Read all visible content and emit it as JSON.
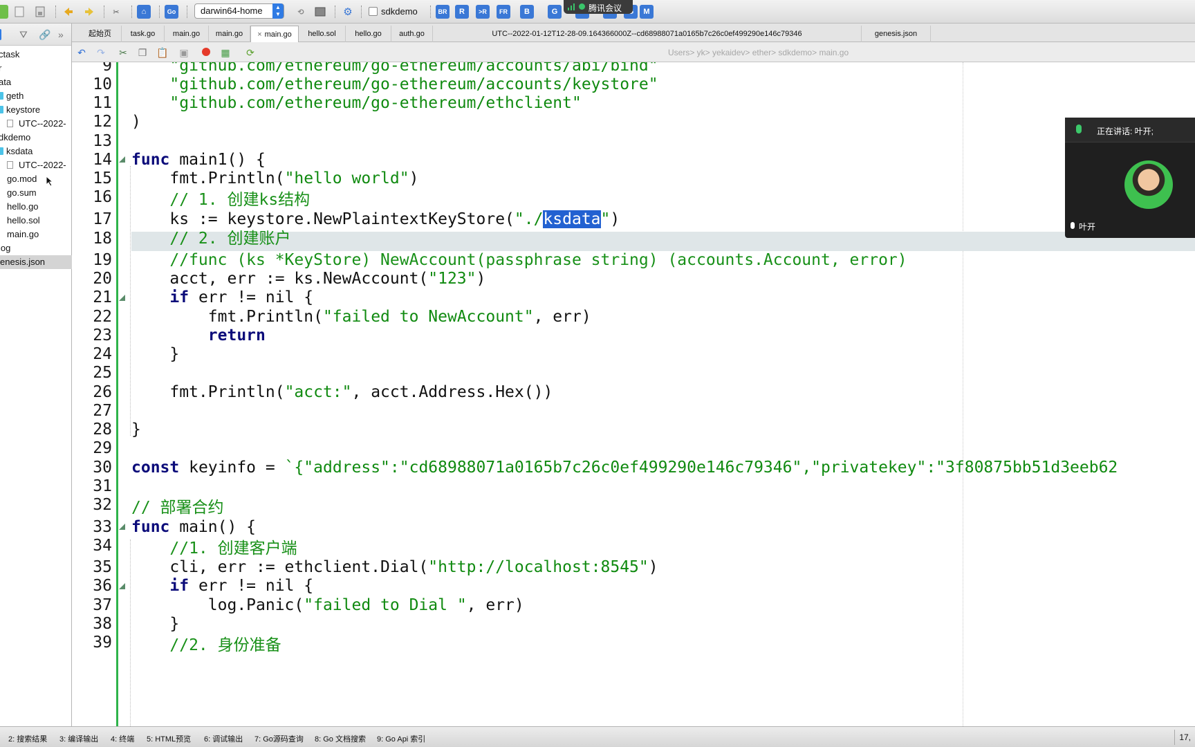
{
  "toolbar": {
    "environment_select": "darwin64-home",
    "checkbox_label": "sdkdemo",
    "checkbox_checked": false,
    "meeting_badge": "腾讯会议",
    "icons": [
      "back-icon",
      "new-file-icon",
      "save-icon",
      "prev-icon",
      "next-icon",
      "tools-icon",
      "home-icon",
      "go-icon",
      "refresh-icon",
      "terminal-icon",
      "settings-icon",
      "br-icon",
      "r-icon",
      "run-r-icon",
      "fr-icon",
      "b-icon",
      "g-icon",
      "m-icon"
    ]
  },
  "sidebar": {
    "items": [
      {
        "label": "ctask",
        "type": "folder-open"
      },
      {
        "label": "r",
        "type": "folder-open"
      },
      {
        "label": "ata",
        "type": "folder-open"
      },
      {
        "label": "geth",
        "type": "folder"
      },
      {
        "label": "keystore",
        "type": "folder"
      },
      {
        "label": "UTC--2022-",
        "type": "file"
      },
      {
        "label": "dkdemo",
        "type": "folder-open"
      },
      {
        "label": "ksdata",
        "type": "folder"
      },
      {
        "label": "UTC--2022-",
        "type": "file"
      },
      {
        "label": "go.mod",
        "type": "file"
      },
      {
        "label": "go.sum",
        "type": "file"
      },
      {
        "label": "hello.go",
        "type": "file"
      },
      {
        "label": "hello.sol",
        "type": "file"
      },
      {
        "label": "main.go",
        "type": "file"
      },
      {
        "label": "log",
        "type": "folder"
      },
      {
        "label": "enesis.json",
        "type": "file",
        "selected": true
      }
    ]
  },
  "tabs": [
    {
      "label": "起始页"
    },
    {
      "label": "task.go"
    },
    {
      "label": "main.go"
    },
    {
      "label": "main.go"
    },
    {
      "label": "main.go",
      "active": true,
      "closable": true
    },
    {
      "label": "hello.sol"
    },
    {
      "label": "hello.go"
    },
    {
      "label": "auth.go"
    },
    {
      "label": "UTC--2022-01-12T12-28-09.164366000Z--cd68988071a0165b7c26c0ef499290e146c79346"
    },
    {
      "label": "genesis.json"
    }
  ],
  "breadcrumb": "Users> yk> yekaidev> ether> sdkdemo> main.go",
  "editor": {
    "current_line": 17,
    "selected_text": "ksdata",
    "lines": [
      {
        "n": "9"
      },
      {
        "n": "10"
      },
      {
        "n": "11"
      },
      {
        "n": "12"
      },
      {
        "n": "13"
      },
      {
        "n": "14"
      },
      {
        "n": "15"
      },
      {
        "n": "16"
      },
      {
        "n": "17"
      },
      {
        "n": "18"
      },
      {
        "n": "19"
      },
      {
        "n": "20"
      },
      {
        "n": "21"
      },
      {
        "n": "22"
      },
      {
        "n": "23"
      },
      {
        "n": "24"
      },
      {
        "n": "25"
      },
      {
        "n": "26"
      },
      {
        "n": "27"
      },
      {
        "n": "28"
      },
      {
        "n": "29"
      },
      {
        "n": "30"
      },
      {
        "n": "31"
      },
      {
        "n": "32"
      },
      {
        "n": "33"
      },
      {
        "n": "34"
      },
      {
        "n": "35"
      },
      {
        "n": "36"
      },
      {
        "n": "37"
      },
      {
        "n": "38"
      },
      {
        "n": "39"
      }
    ],
    "code": {
      "l9": "\"github.com/ethereum/go-ethereum/accounts/abi/bind\"",
      "l10": "\"github.com/ethereum/go-ethereum/accounts/keystore\"",
      "l11": "\"github.com/ethereum/go-ethereum/ethclient\"",
      "l12": ")",
      "l14_kw": "func",
      "l14_rest": " main1() {",
      "l15_a": "fmt.Println(",
      "l15_s": "\"hello world\"",
      "l15_b": ")",
      "l16": "// 1. 创建ks结构",
      "l17_a": "ks := keystore.NewPlaintextKeyStore(",
      "l17_s1": "\"./",
      "l17_sel": "ksdata",
      "l17_s2": "\"",
      "l17_b": ")",
      "l18": "// 2. 创建账户",
      "l19": "//func (ks *KeyStore) NewAccount(passphrase string) (accounts.Account, error)",
      "l20_a": "acct, err := ks.NewAccount(",
      "l20_s": "\"123\"",
      "l20_b": ")",
      "l21_kw": "if",
      "l21_rest": " err != nil {",
      "l22_a": "fmt.Println(",
      "l22_s": "\"failed to NewAccount\"",
      "l22_b": ", err)",
      "l23_kw": "return",
      "l24": "}",
      "l26_a": "fmt.Println(",
      "l26_s": "\"acct:\"",
      "l26_b": ", acct.Address.Hex())",
      "l28": "}",
      "l30_kw": "const",
      "l30_a": " keyinfo = ",
      "l30_s": "`{\"address\":\"cd68988071a0165b7c26c0ef499290e146c79346\",\"privatekey\":\"3f80875bb51d3eeb62",
      "l32": "// 部署合约",
      "l33_kw": "func",
      "l33_rest": " main() {",
      "l34": "//1. 创建客户端",
      "l35_a": "cli, err := ethclient.Dial(",
      "l35_s": "\"http://localhost:8545\"",
      "l35_b": ")",
      "l36_kw": "if",
      "l36_rest": " err != nil {",
      "l37_a": "log.Panic(",
      "l37_s": "\"failed to Dial \"",
      "l37_b": ", err)",
      "l38": "}",
      "l39": "//2. 身份准备"
    }
  },
  "meeting": {
    "speaking_label": "正在讲话: 叶开;",
    "participant_name": "叶开"
  },
  "statusbar": {
    "items": [
      "2: 搜索结果",
      "3: 编译输出",
      "4: 终端",
      "5: HTML预览",
      "6: 调试输出",
      "7: Go源码查询",
      "8: Go 文档搜索",
      "9: Go Api 索引"
    ],
    "position": "17,"
  },
  "colors": {
    "string": "#108a10",
    "keyword": "#0c0c7a",
    "comment": "#189018",
    "selection": "#2261d1",
    "gutter_bar": "#2eb34a",
    "current_line": "#dfe6e8"
  }
}
